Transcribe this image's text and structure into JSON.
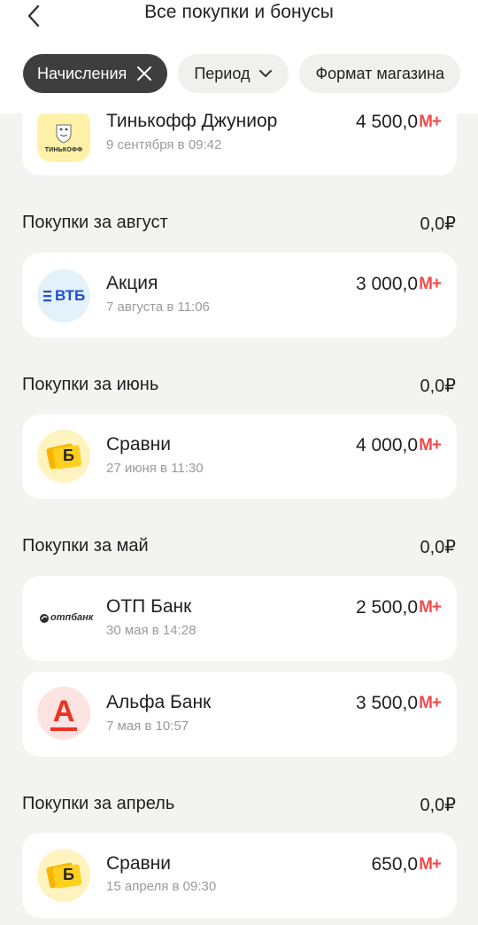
{
  "header": {
    "title": "Все покупки и бонусы",
    "back_icon": "chevron-left-icon"
  },
  "filters": [
    {
      "label": "Начисления",
      "active": true,
      "icon": "close-icon"
    },
    {
      "label": "Период",
      "active": false,
      "icon": "chevron-down-icon"
    },
    {
      "label": "Формат магазина",
      "active": false
    }
  ],
  "bonus_badge": "М+",
  "top_item": {
    "merchant": "Тинькофф Джуниор",
    "datetime": "9 сентября в 09:42",
    "amount": "4 500,0",
    "logo_text": "ТИНЬКОФФ"
  },
  "sections": [
    {
      "title": "Покупки за август",
      "sum": "0,0₽",
      "items": [
        {
          "merchant": "Акция",
          "datetime": "7 августа в 11:06",
          "amount": "3 000,0",
          "logo_text": "ВТБ"
        }
      ]
    },
    {
      "title": "Покупки за июнь",
      "sum": "0,0₽",
      "items": [
        {
          "merchant": "Сравни",
          "datetime": "27 июня в 11:30",
          "amount": "4 000,0",
          "logo_text": "Б"
        }
      ]
    },
    {
      "title": "Покупки за май",
      "sum": "0,0₽",
      "items": [
        {
          "merchant": "ОТП Банк",
          "datetime": "30 мая в 14:28",
          "amount": "2 500,0",
          "logo_text": "отпбанк"
        },
        {
          "merchant": "Альфа Банк",
          "datetime": "7 мая в 10:57",
          "amount": "3 500,0",
          "logo_text": "А"
        }
      ]
    },
    {
      "title": "Покупки за апрель",
      "sum": "0,0₽",
      "items": [
        {
          "merchant": "Сравни",
          "datetime": "15 апреля в 09:30",
          "amount": "650,0",
          "logo_text": "Б"
        }
      ]
    }
  ],
  "colors": {
    "accent": "#f24a4a",
    "chip_active": "#3e3e3e",
    "background": "#f3f3f1",
    "vtb_blue": "#1f4fd6",
    "alfa_red": "#ef3124",
    "sravni_yellow": "#ffd21f",
    "otp_green": "#52ae30"
  }
}
